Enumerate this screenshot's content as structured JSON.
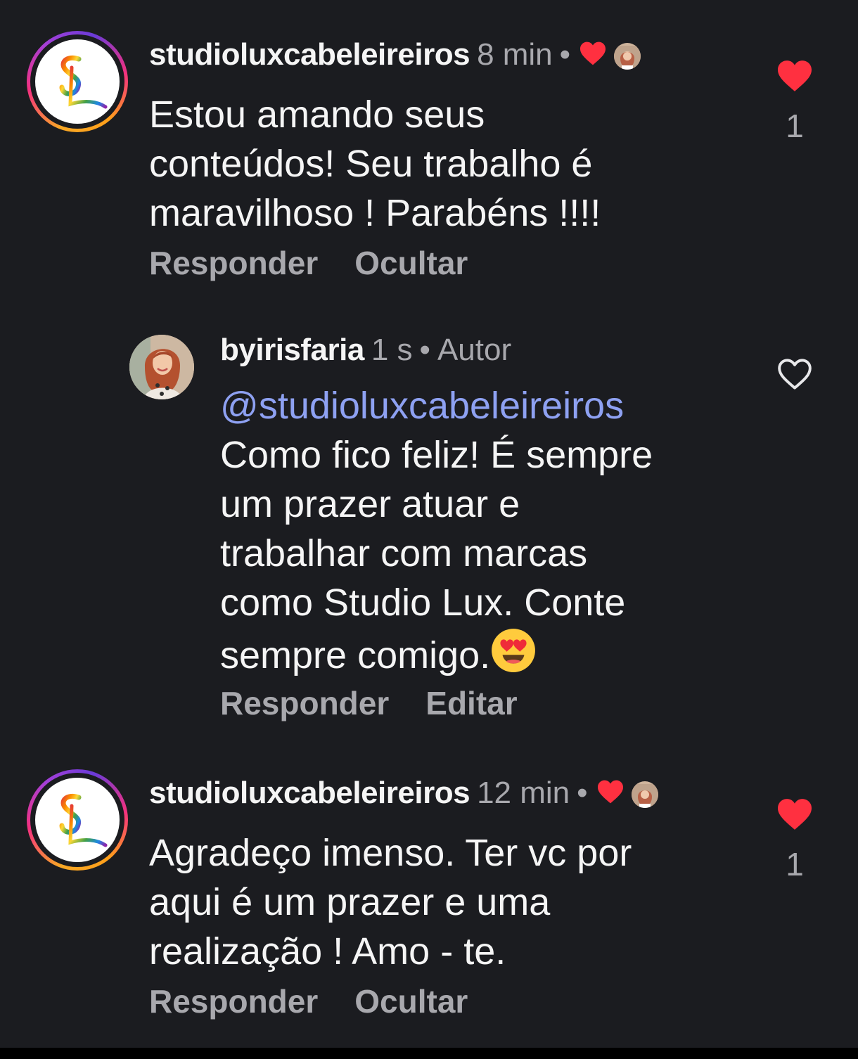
{
  "comments": [
    {
      "username": "studioluxcabeleireiros",
      "time": "8 min",
      "separator": "•",
      "text_lines": [
        "Estou amando seus",
        "conteúdos! Seu trabalho é",
        "maravilhoso ! Parabéns !!!!"
      ],
      "actions": [
        "Responder",
        "Ocultar"
      ],
      "like_count": "1",
      "liked": true,
      "liked_by_author": true
    },
    {
      "username": "byirisfaria",
      "time": "1 s",
      "separator": "•",
      "badge": "Autor",
      "mention": "@studioluxcabeleireiros",
      "text_lines": [
        "Como fico feliz!  É sempre",
        "um prazer atuar e",
        "trabalhar com marcas",
        "como Studio Lux. Conte",
        "sempre comigo."
      ],
      "emoji": "heart-eyes",
      "actions": [
        "Responder",
        "Editar"
      ],
      "liked": false
    },
    {
      "username": "studioluxcabeleireiros",
      "time": "12 min",
      "separator": "•",
      "text_lines": [
        "Agradeço imenso. Ter vc por",
        "aqui é um prazer e uma",
        "realização ! Amo - te."
      ],
      "actions": [
        "Responder",
        "Ocultar"
      ],
      "like_count": "1",
      "liked": true,
      "liked_by_author": true
    }
  ],
  "colors": {
    "background": "#1b1c20",
    "primary_text": "#f5f5f5",
    "secondary_text": "#a8a8ad",
    "mention": "#8ea1f2",
    "like_red": "#ff3040"
  },
  "icons": {
    "liked": "heart-filled-icon",
    "unliked": "heart-outline-icon"
  }
}
